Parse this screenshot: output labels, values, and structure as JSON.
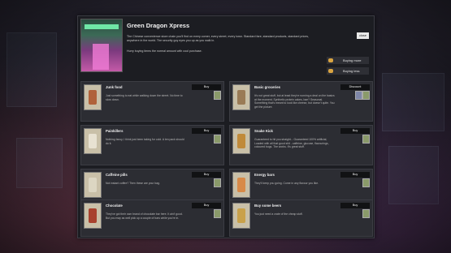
{
  "shop": {
    "name": "Green Dragon Xpress",
    "description": "The Chinese convenience store chain you'll find on every corner, every street, every town. Standard fare, standard products, standard prices, anywhere in the world. The security guy eyes you up as you walk in.",
    "prompt": "Hurry buying items the normal amount with cool purchase.",
    "close_label": "close",
    "buy_mode_label": "Buying more",
    "buy_less_label": "Buying less"
  },
  "items": [
    {
      "title": "Junk food",
      "desc": "Just something to eat while walking down the street. No time to slow down.",
      "action": "Buy",
      "thumb_color": "#b0623a"
    },
    {
      "title": "Basic groceries",
      "desc": "It's not great stuff, but at least they're running a deal on the basics at the moment. Synthetic protein cakes, bae? Seasonal. Something that's meant to look like cheese, but doesn't quite. You get the picture.",
      "action": "Discount",
      "thumb_color": "#9a7b56"
    },
    {
      "title": "Painkillers",
      "desc": "Nothing fancy, I think just been taking for cold. A ten pack should do it.",
      "action": "Buy",
      "thumb_color": "#e8e2d2"
    },
    {
      "title": "Snake Kick",
      "desc": "Guaranteed to hit you straight... Guaranteed 100% artificial, Loaded with all that good shit - caffeine, glucose, flavourings, coloured bugs. The works. It's great stuff.",
      "action": "Buy",
      "thumb_color": "#c08a3a"
    },
    {
      "title": "Caffeine pills",
      "desc": "Not instant coffee? Then these are your bag.",
      "action": "Buy",
      "thumb_color": "#dcd6c2"
    },
    {
      "title": "Energy bars",
      "desc": "They'll keep you going. Come in any flavour you like.",
      "action": "Buy",
      "thumb_color": "#d88a48"
    },
    {
      "title": "Chocolate",
      "desc": "They've got their own brand of chocolate bar here. It ain't good. But you may as well pick up a couple of bars while you're in.",
      "action": "Buy",
      "thumb_color": "#a8422e"
    },
    {
      "title": "Buy some beers",
      "desc": "You just need a crate of the cheap stuff.",
      "action": "Buy",
      "thumb_color": "#c9a14a"
    }
  ]
}
